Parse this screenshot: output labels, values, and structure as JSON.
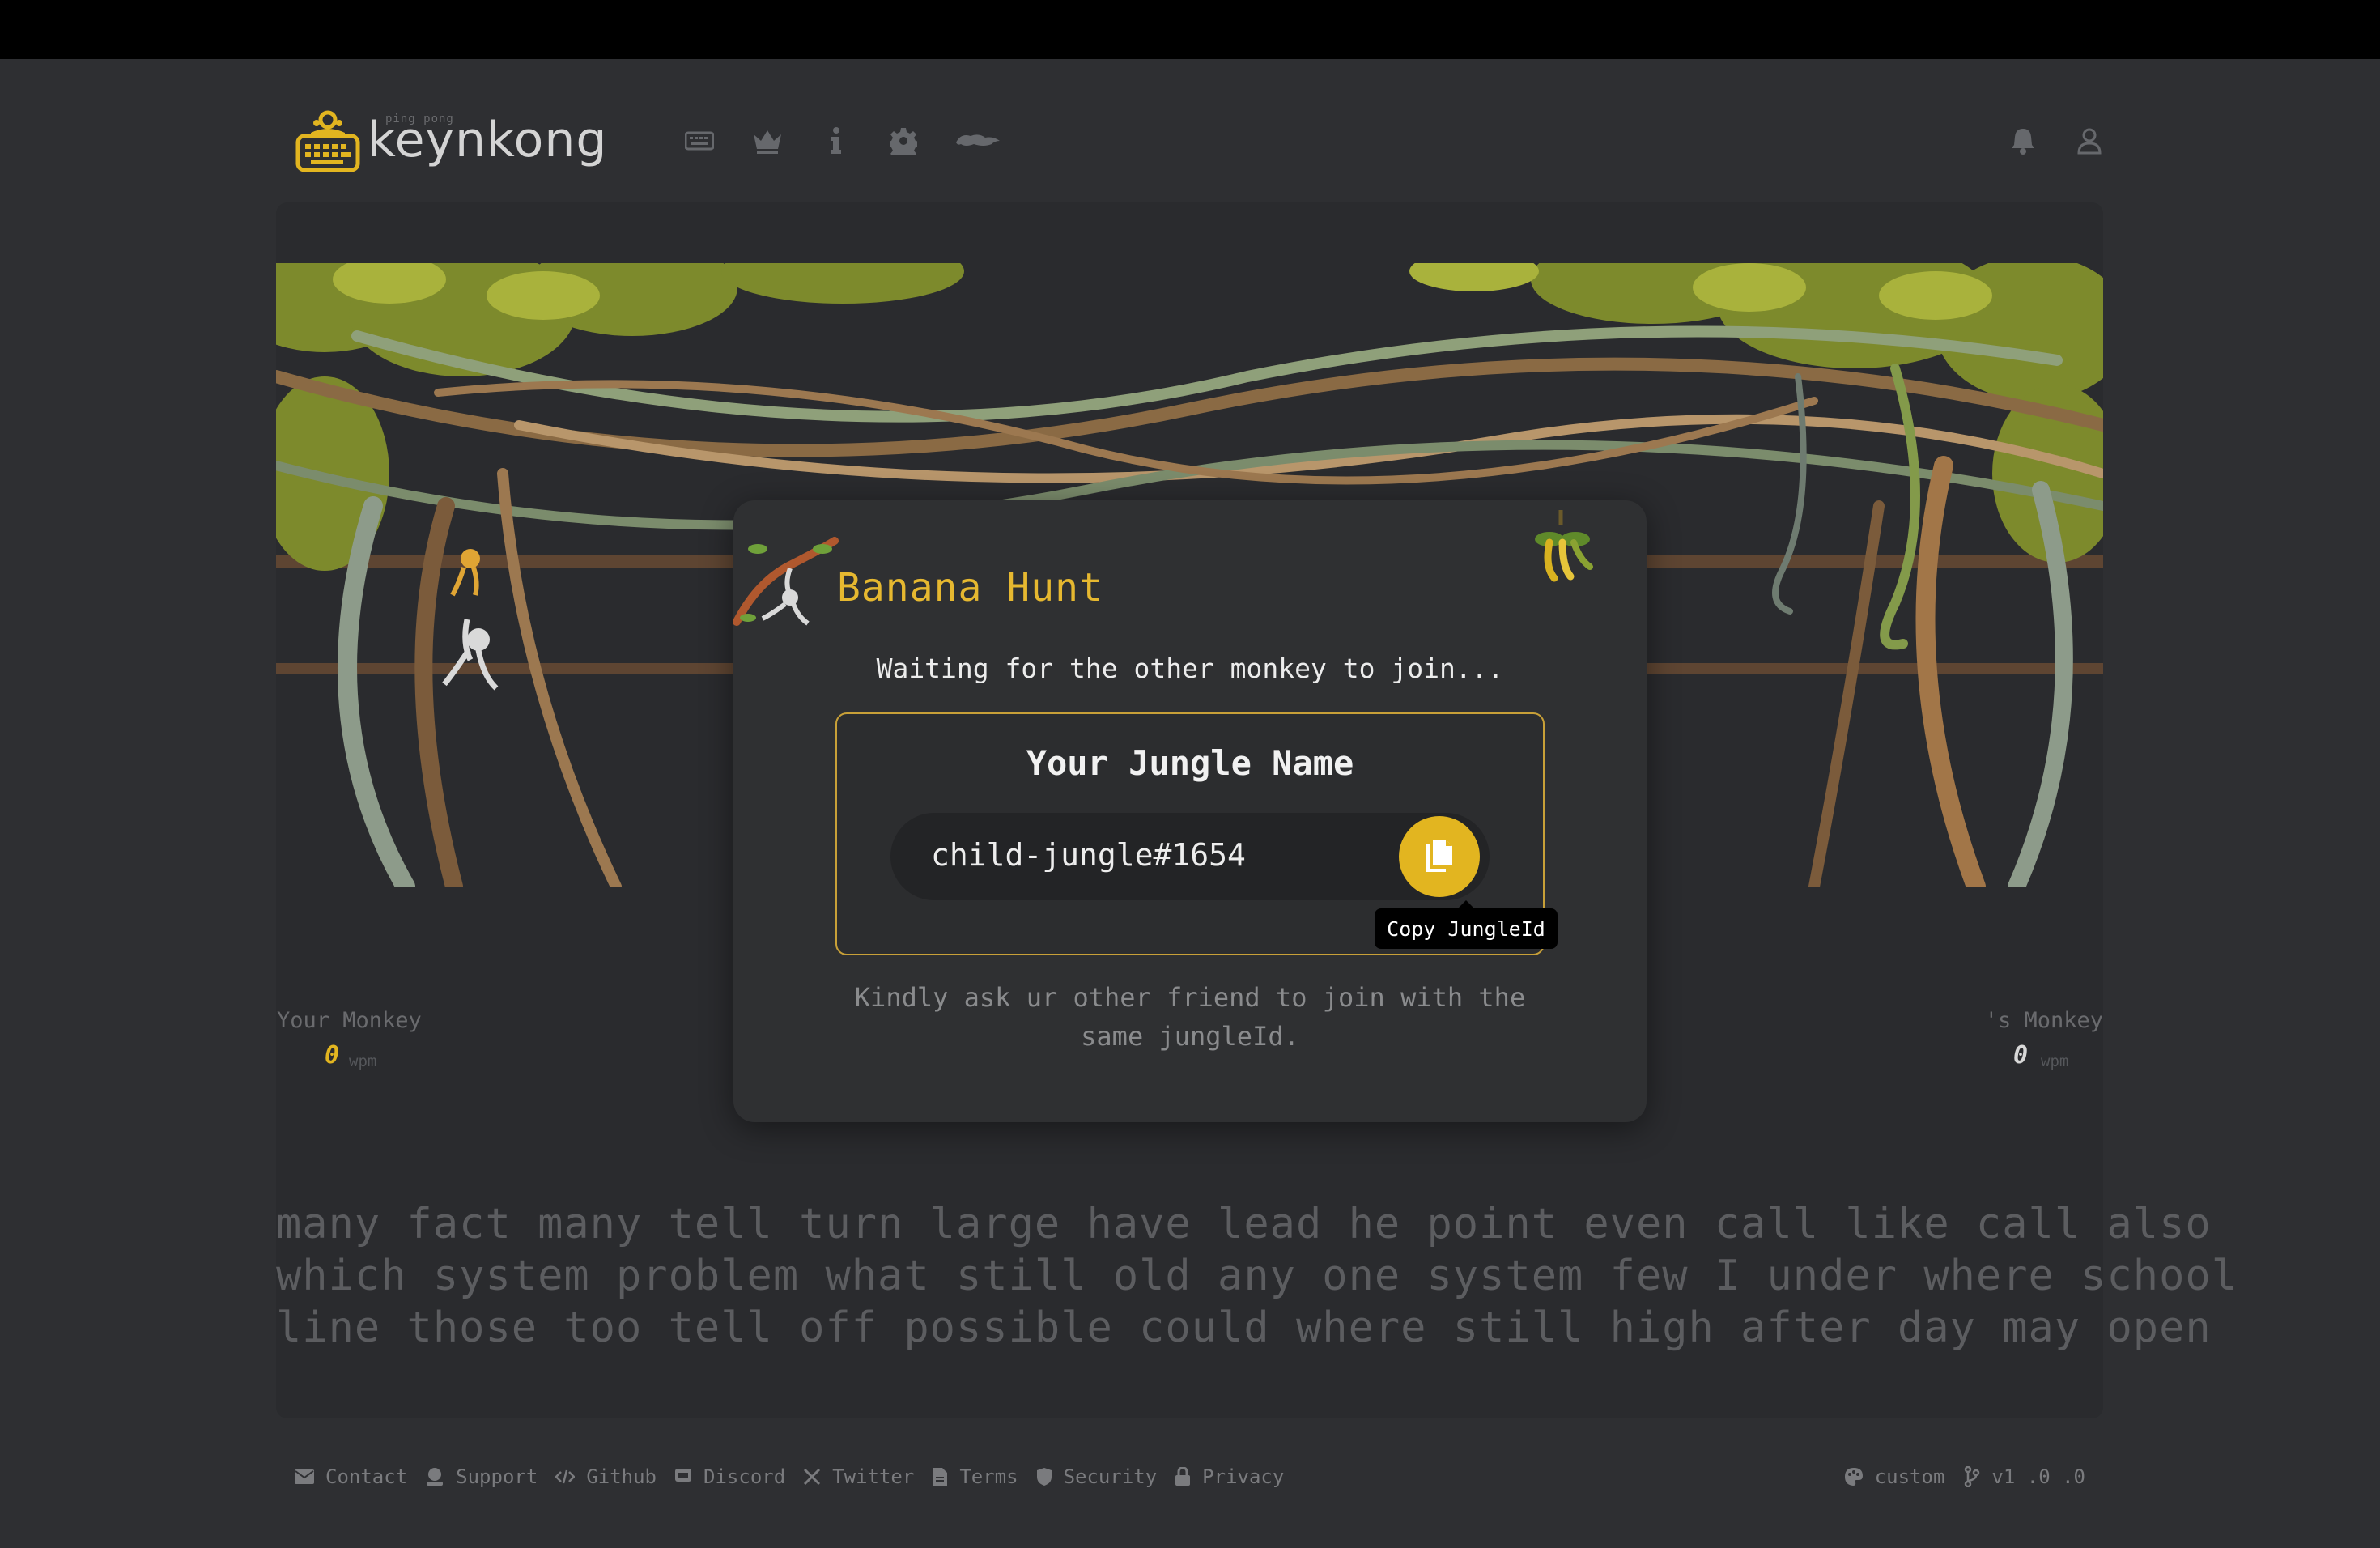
{
  "app": {
    "logo_small": "ping pong",
    "logo_name": "keynkong"
  },
  "nav": {
    "items": [
      "keyboard-icon",
      "crown-icon",
      "info-icon",
      "gear-icon",
      "monkey-icon"
    ],
    "right": [
      "bell-icon",
      "user-icon"
    ]
  },
  "race": {
    "your_monkey_label": "Your Monkey",
    "your_wpm": "0",
    "other_monkey_label": "'s Monkey",
    "other_wpm": "0",
    "wpm_unit": "wpm"
  },
  "modal": {
    "title": "Banana Hunt",
    "subtitle": "Waiting for the other monkey to join...",
    "box_title": "Your Jungle Name",
    "jungle_id": "child-jungle#1654",
    "copy_tooltip": "Copy JungleId",
    "hint": "Kindly ask ur other friend to join with the same jungleId."
  },
  "words": {
    "line1": "many fact many tell turn large have lead he point even call like call also",
    "line2": "which system problem what still old any one system few I under where school",
    "line3": "line those too tell off possible could where still high after day may open"
  },
  "footer": {
    "links": [
      "Contact",
      "Support",
      "Github",
      "Discord",
      "Twitter",
      "Terms",
      "Security",
      "Privacy"
    ],
    "theme": "custom",
    "version": "v1 .0 .0"
  },
  "colors": {
    "accent": "#e2b520",
    "background": "#2e2f32",
    "panel": "#2a2b2e",
    "modal": "#2f3032"
  }
}
